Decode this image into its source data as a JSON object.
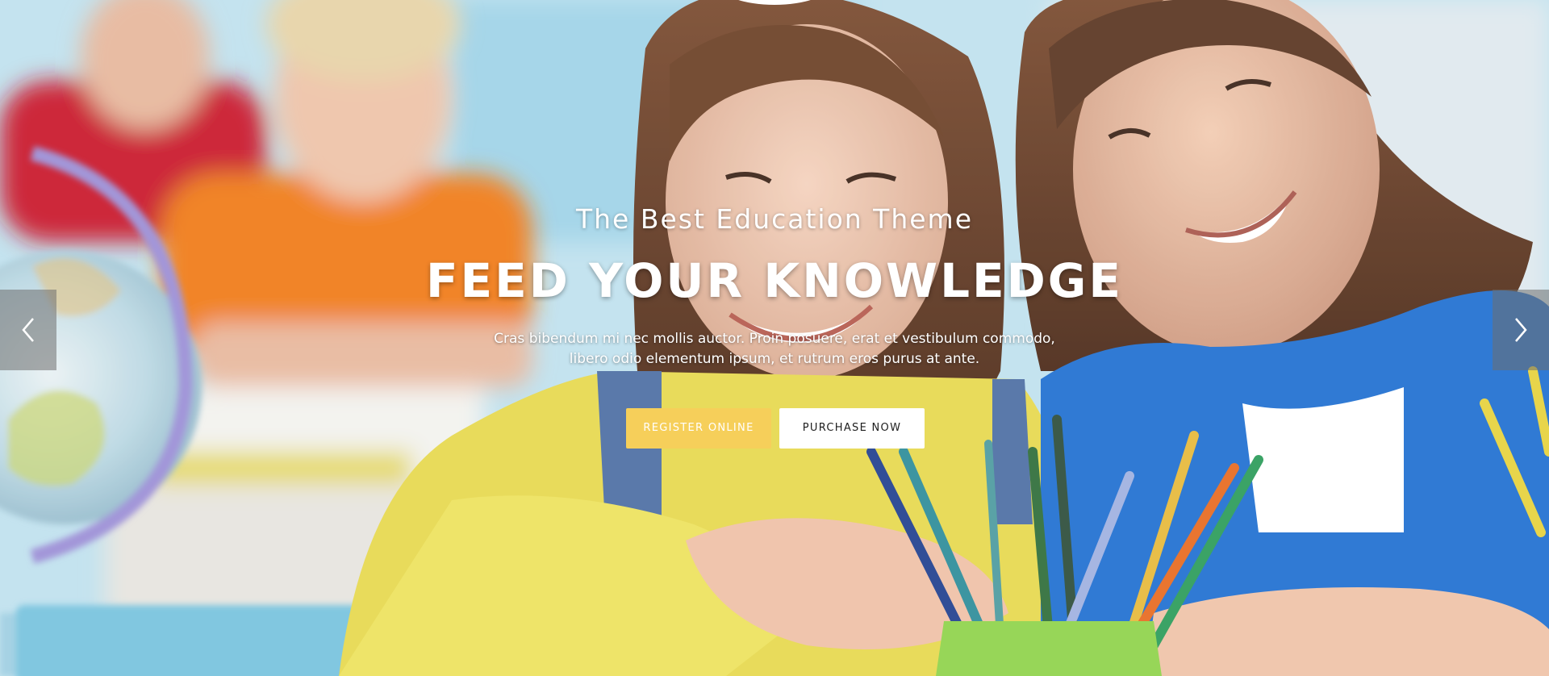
{
  "hero": {
    "subtitle": "The Best Education Theme",
    "title": "FEED YOUR KNOWLEDGE",
    "description_line1": "Cras bibendum mi nec mollis auctor. Proin posuere, erat et vestibulum commodo,",
    "description_line2": "libero odio elementum ipsum, et rutrum eros purus at ante."
  },
  "buttons": {
    "register_label": "REGISTER ONLINE",
    "purchase_label": "PURCHASE NOW"
  },
  "slider": {
    "prev_icon": "chevron-left-icon",
    "next_icon": "chevron-right-icon"
  },
  "colors": {
    "register_button": "#f6cf5a",
    "purchase_button": "#ffffff",
    "arrow_background": "#6e6e6e"
  }
}
